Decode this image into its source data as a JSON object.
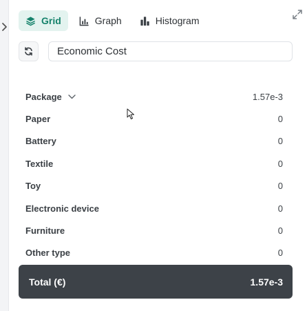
{
  "tabs": [
    {
      "label": "Grid",
      "icon": "layers-icon",
      "active": true
    },
    {
      "label": "Graph",
      "icon": "bar-chart-icon",
      "active": false
    },
    {
      "label": "Histogram",
      "icon": "histogram-icon",
      "active": false
    }
  ],
  "metric": {
    "value": "Economic Cost"
  },
  "table": {
    "group_label": "Package",
    "group_value": "1.57e-3",
    "rows": [
      {
        "label": "Paper",
        "value": "0"
      },
      {
        "label": "Battery",
        "value": "0"
      },
      {
        "label": "Textile",
        "value": "0"
      },
      {
        "label": "Toy",
        "value": "0"
      },
      {
        "label": "Electronic device",
        "value": "0"
      },
      {
        "label": "Furniture",
        "value": "0"
      },
      {
        "label": "Other type",
        "value": "0"
      }
    ]
  },
  "total": {
    "label": "Total (€)",
    "value": "1.57e-3"
  },
  "colors": {
    "accent": "#16836c",
    "accent_bg": "#e3f3ef",
    "total_bg": "#3d4248"
  }
}
